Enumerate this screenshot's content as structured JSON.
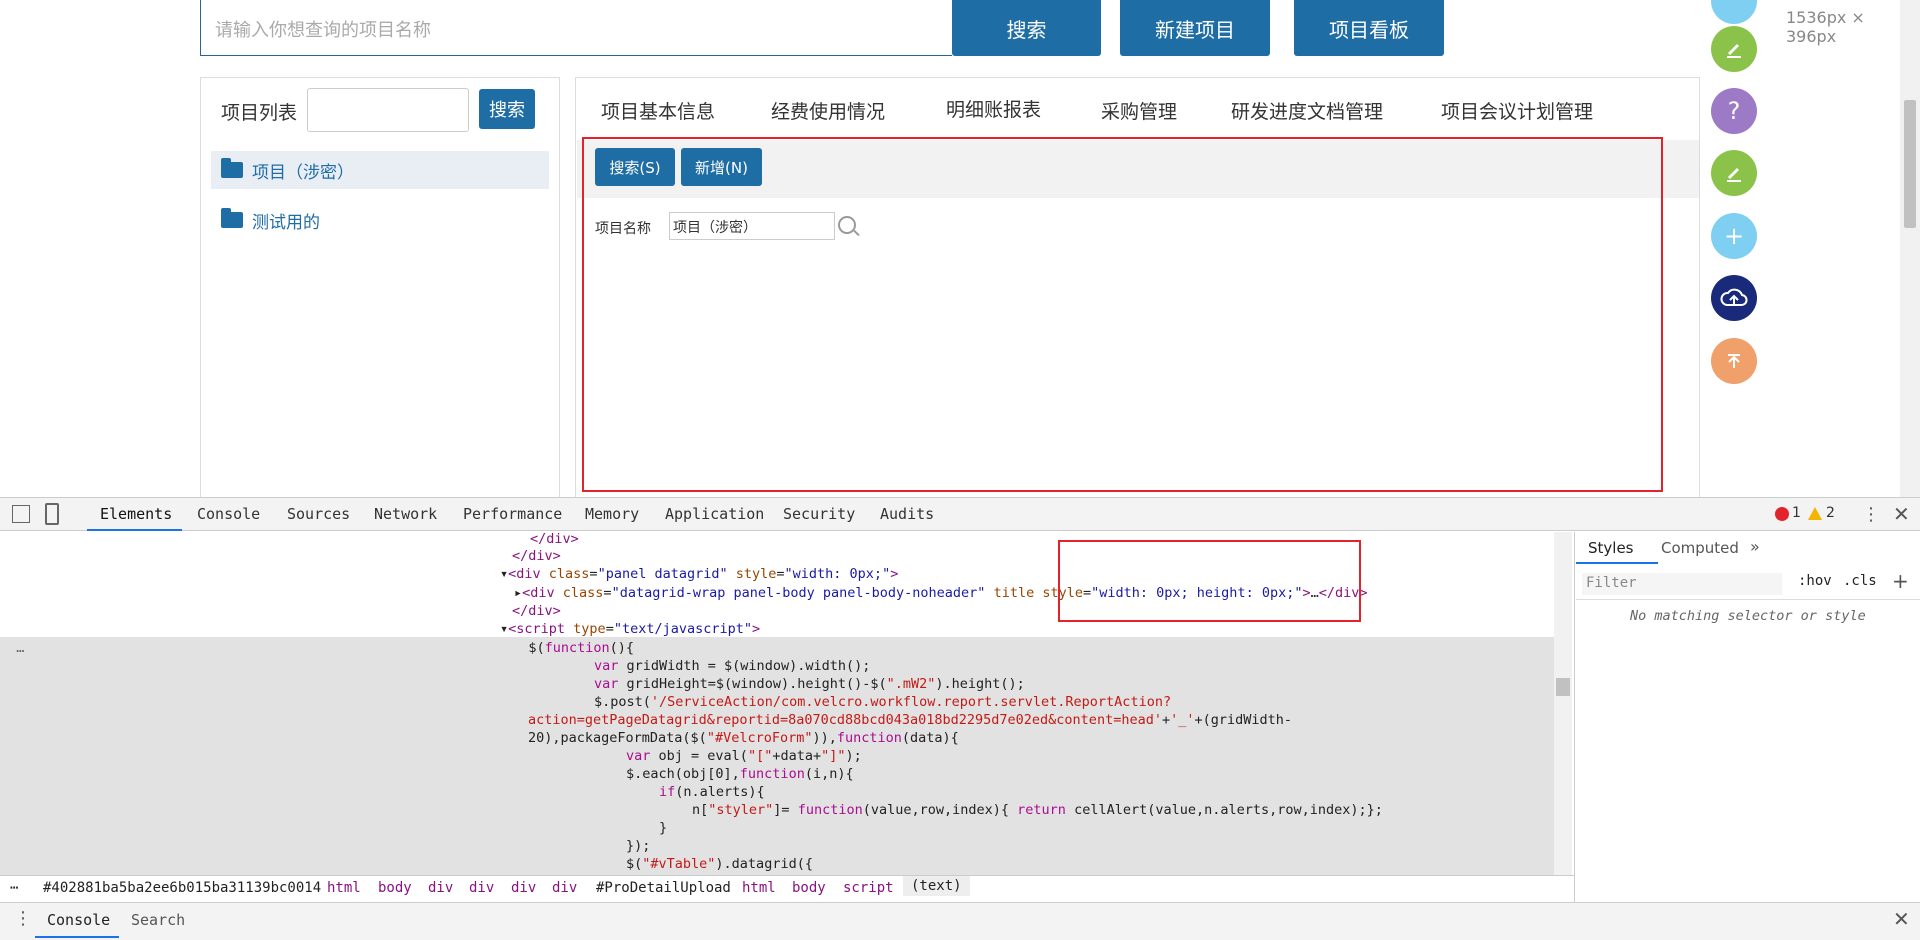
{
  "top": {
    "search_placeholder": "请输入你想查询的项目名称",
    "search_button": "搜索",
    "new_project_button": "新建项目",
    "project_board_button": "项目看板",
    "viewport_size": "1536px × 396px"
  },
  "left_panel": {
    "title": "项目列表",
    "search_button": "搜索",
    "items": [
      {
        "label": "项目（涉密）"
      },
      {
        "label": "测试用的"
      }
    ]
  },
  "tabs": [
    "项目基本信息",
    "经费使用情况",
    "明细账报表",
    "采购管理",
    "研发进度文档管理",
    "项目会议计划管理"
  ],
  "toolbar": {
    "search_label": "搜索(S)",
    "add_label": "新增(N)"
  },
  "form": {
    "project_name_label": "项目名称",
    "project_name_value": "项目（涉密）"
  },
  "devtools": {
    "tabs": [
      "Elements",
      "Console",
      "Sources",
      "Network",
      "Performance",
      "Memory",
      "Application",
      "Security",
      "Audits"
    ],
    "errors": "1",
    "warnings": "2",
    "styles_tabs": [
      "Styles",
      "Computed"
    ],
    "filter_placeholder": "Filter",
    "hov": ":hov",
    "cls": ".cls",
    "no_match": "No matching selector or style",
    "breadcrumb": [
      "#402881ba5ba2ee6b015ba31139bc0014",
      "html",
      "body",
      "div",
      "div",
      "div",
      "div",
      "#ProDetailUpload",
      "html",
      "body",
      "script",
      "(text)"
    ],
    "drawer_tabs": [
      "Console",
      "Search"
    ]
  },
  "colors": {
    "primary": "#1f6da5",
    "highlight": "#e3232b"
  }
}
